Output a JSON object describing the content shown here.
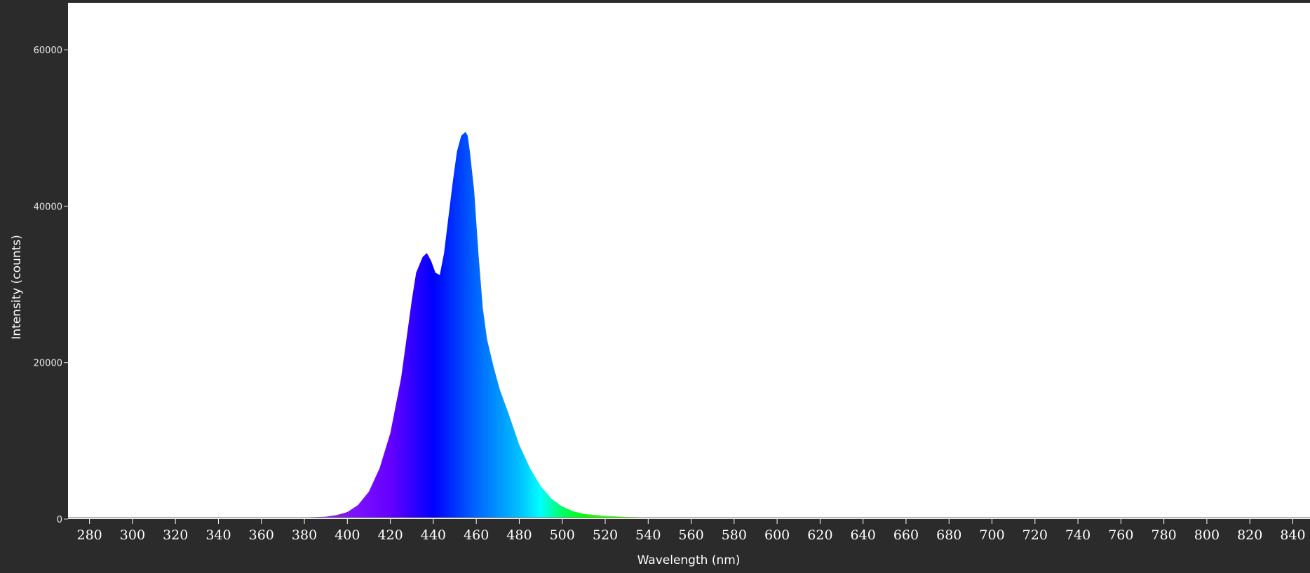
{
  "chart_data": {
    "type": "area",
    "title": "",
    "xlabel": "Wavelength (nm)",
    "ylabel": "Intensity (counts)",
    "xlim": [
      270,
      848
    ],
    "ylim": [
      0,
      66000
    ],
    "x_ticks": [
      "280",
      "300",
      "320",
      "340",
      "360",
      "380",
      "400",
      "420",
      "440",
      "460",
      "480",
      "500",
      "520",
      "540",
      "560",
      "580",
      "600",
      "620",
      "640",
      "660",
      "680",
      "700",
      "720",
      "740",
      "760",
      "780",
      "800",
      "820",
      "840"
    ],
    "y_ticks": [
      "0",
      "20000",
      "40000",
      "60000"
    ],
    "grid": false,
    "fill": "visible-spectrum gradient",
    "series": [
      {
        "x": [
          270,
          300,
          350,
          380,
          390,
          395,
          400,
          405,
          410,
          415,
          420,
          425,
          428,
          430,
          432,
          435,
          437,
          439,
          441,
          443,
          445,
          447,
          449,
          451,
          453,
          455,
          456,
          457,
          459,
          461,
          463,
          465,
          468,
          471,
          475,
          480,
          485,
          490,
          495,
          500,
          505,
          510,
          520,
          530,
          540,
          560,
          600,
          650,
          700,
          848
        ],
        "y": [
          100,
          100,
          150,
          200,
          300,
          500,
          900,
          1800,
          3500,
          6500,
          11000,
          18000,
          24000,
          28000,
          31500,
          33500,
          34000,
          33000,
          31500,
          31200,
          34000,
          38500,
          43000,
          47000,
          49000,
          49500,
          49000,
          47000,
          42000,
          34000,
          27000,
          23000,
          19500,
          16500,
          13500,
          9500,
          6500,
          4200,
          2600,
          1600,
          1000,
          650,
          400,
          280,
          200,
          120,
          80,
          60,
          50,
          40
        ]
      }
    ]
  }
}
